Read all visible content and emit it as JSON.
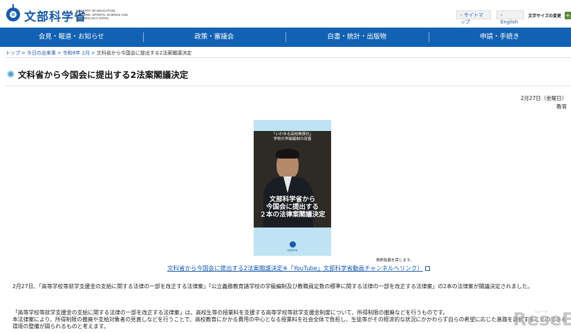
{
  "header": {
    "logo_text": "文部科学省",
    "logo_sub": "MINISTRY OF EDUCATION, CULTURE, SPORTS, SCIENCE AND TECHNOLOGY-JAPAN",
    "sitemap": "サイトマップ",
    "english": "English",
    "font_size_label": "文字サイズの変更",
    "font_button": "+"
  },
  "nav": {
    "items": [
      {
        "label": "会見・報道・お知らせ"
      },
      {
        "label": "政策・審議会"
      },
      {
        "label": "白書・統計・出版物"
      },
      {
        "label": "申請・手続き"
      }
    ]
  },
  "breadcrumb": {
    "items": [
      "トップ",
      "今日の出来事",
      "令和8年 2月",
      "文科省から今国会に提出する2法案閣議決定"
    ],
    "separator": ">"
  },
  "page": {
    "title": "文科省から今国会に提出する2法案閣議決定",
    "date": "2月27日（金曜日）",
    "category": "教育"
  },
  "video": {
    "top_text_1": "「いわゆる高校無償化」",
    "top_text_2": "学校の学級編制の改善",
    "caption_1": "文部科学省から",
    "caption_2": "今国会に提出する",
    "caption_3": "２本の法律案閣議決定",
    "logo_text": "文部科学省",
    "notice": "無断転載を禁じます。",
    "link": "文科省から今国会に提出する2法案閣議決定※「YouTube」文部科学省動画チャンネルへリンク）"
  },
  "body": {
    "p1": "2月27日、「高等学校等就学支援金の支給に関する法律の一部を改正する法律案」「公立義務教育諸学校の学級編制及び教職員定数の標準に関する法律の一部を改正する法律案」の2本の法律案が閣議決定されました。",
    "p2a": "「高等学校等就学支援金の支給に関する法律の一部を改正する法律案」は、高校生等の授業料を支援する高等学校等就学支援金制度について、所得制限の撤廃などを行うものです。",
    "p2b": "本法律案により、所得制限の撤廃や支給対象者の見直しなどを行うことで、高校教育にかかる費用の中心となる授業料を社会全体で負担し、生徒等がその経済的な状況にかかわらず自らの希望に応じた進路を選択することのできる環境の整備が図られるものと考えます。"
  },
  "watermark": {
    "text": "ReseE",
    "sub": "リシード"
  }
}
